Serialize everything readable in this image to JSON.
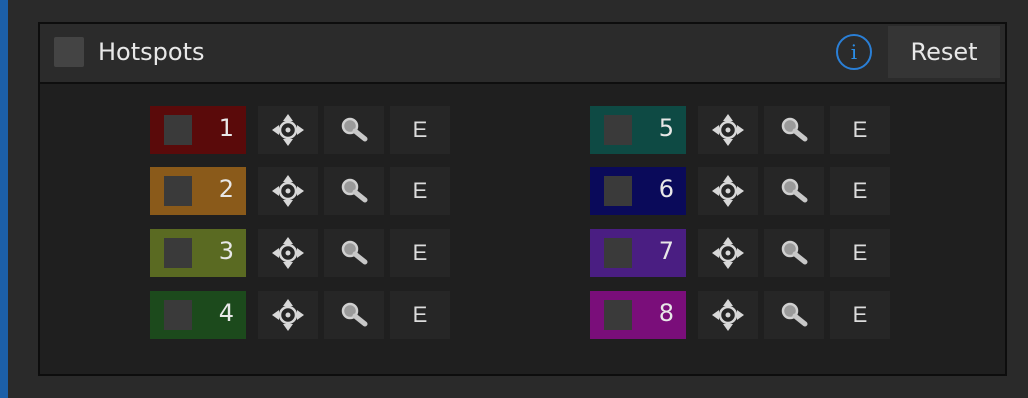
{
  "panel": {
    "title": "Hotspots",
    "info_label": "i",
    "reset_label": "Reset"
  },
  "hotspots": [
    {
      "number": "1",
      "color": "#5a0a0a",
      "edit_label": "E"
    },
    {
      "number": "2",
      "color": "#8a5a1a",
      "edit_label": "E"
    },
    {
      "number": "3",
      "color": "#5a6a22",
      "edit_label": "E"
    },
    {
      "number": "4",
      "color": "#1c4a1c",
      "edit_label": "E"
    },
    {
      "number": "5",
      "color": "#0e4a44",
      "edit_label": "E"
    },
    {
      "number": "6",
      "color": "#0a0a5a",
      "edit_label": "E"
    },
    {
      "number": "7",
      "color": "#4a1e82",
      "edit_label": "E"
    },
    {
      "number": "8",
      "color": "#7a0e7a",
      "edit_label": "E"
    }
  ],
  "icons": {
    "move": "move-icon",
    "zoom": "magnifier-icon",
    "info": "info-icon"
  },
  "colors": {
    "accent": "#1c5fa8",
    "info": "#2a8ee8"
  }
}
